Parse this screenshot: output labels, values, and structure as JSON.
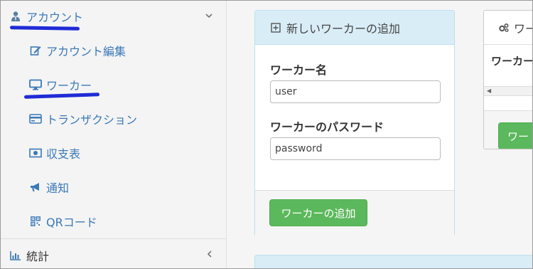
{
  "sidebar": {
    "account": {
      "label": "アカウント",
      "icon": "user-tie-icon"
    },
    "items": [
      {
        "label": "アカウント編集",
        "icon": "edit-icon"
      },
      {
        "label": "ワーカー",
        "icon": "desktop-icon"
      },
      {
        "label": "トランザクション",
        "icon": "credit-card-icon"
      },
      {
        "label": "収支表",
        "icon": "money-bill-icon"
      },
      {
        "label": "通知",
        "icon": "bullhorn-icon"
      },
      {
        "label": "QRコード",
        "icon": "qrcode-icon"
      }
    ],
    "stats": {
      "label": "統計",
      "icon": "bar-chart-icon"
    }
  },
  "add_worker_panel": {
    "title": "新しいワーカーの追加",
    "name_label": "ワーカー名",
    "name_value": "user",
    "password_label": "ワーカーのパスワード",
    "password_value": "password",
    "submit_label": "ワーカーの追加"
  },
  "workers_panel": {
    "title": "ワー",
    "column_header": "ワーカー",
    "button_label": "ワー"
  },
  "colors": {
    "link": "#3a79b8",
    "panel_header": "#d9edf7",
    "success": "#5cb85c",
    "annotation": "#1f2bd6"
  }
}
